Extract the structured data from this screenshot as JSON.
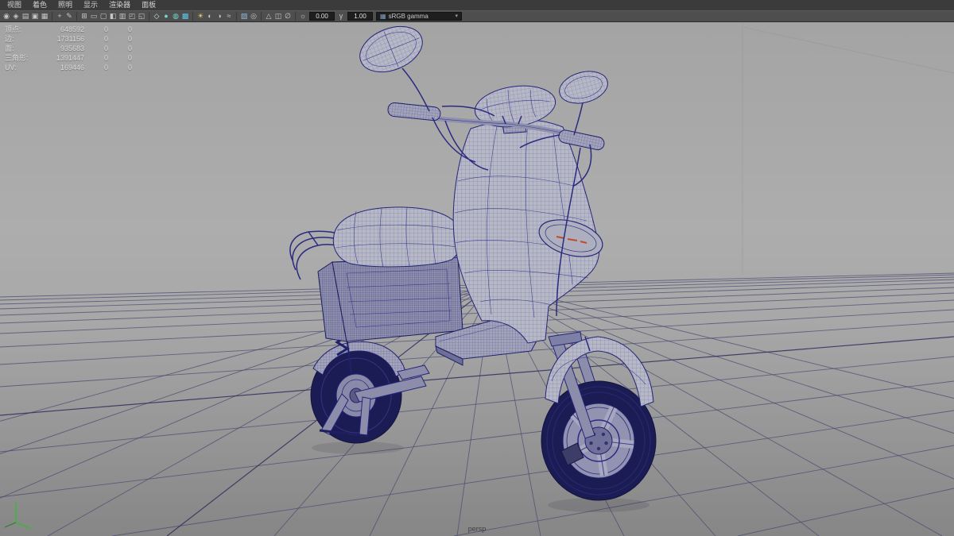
{
  "menu_bar": {
    "items": [
      {
        "name": "menu-view",
        "label": "视图"
      },
      {
        "name": "menu-shading",
        "label": "着色"
      },
      {
        "name": "menu-lighting",
        "label": "照明"
      },
      {
        "name": "menu-show",
        "label": "显示"
      },
      {
        "name": "menu-renderer",
        "label": "渲染器"
      },
      {
        "name": "menu-panels",
        "label": "面板"
      }
    ]
  },
  "toolbar": {
    "groups": {
      "camera": [
        {
          "name": "select-camera-icon",
          "glyph": "◉"
        },
        {
          "name": "lock-camera-icon",
          "glyph": "◈"
        },
        {
          "name": "camera-attributes-icon",
          "glyph": "▤"
        },
        {
          "name": "bookmark-icon",
          "glyph": "▣"
        },
        {
          "name": "image-plane-icon",
          "glyph": "▦"
        }
      ],
      "nav": [
        {
          "name": "pan-zoom-2d-icon",
          "glyph": "+"
        },
        {
          "name": "grease-pencil-icon",
          "glyph": "✎"
        }
      ],
      "gates": [
        {
          "name": "grid-toggle-icon",
          "glyph": "⊞"
        },
        {
          "name": "film-gate-icon",
          "glyph": "▭"
        },
        {
          "name": "resolution-gate-icon",
          "glyph": "▢"
        },
        {
          "name": "gate-mask-icon",
          "glyph": "◧"
        },
        {
          "name": "field-chart-icon",
          "glyph": "▥"
        },
        {
          "name": "safe-action-icon",
          "glyph": "◰"
        },
        {
          "name": "safe-title-icon",
          "glyph": "◱"
        }
      ],
      "shading": [
        {
          "name": "wireframe-icon",
          "glyph": "◇",
          "color": "#bfe8e2"
        },
        {
          "name": "smooth-shade-icon",
          "glyph": "●",
          "color": "#6fd8cb"
        },
        {
          "name": "wireframe-on-shaded-icon",
          "glyph": "◍",
          "color": "#6fd8cb"
        },
        {
          "name": "textured-icon",
          "glyph": "▩",
          "color": "#5fc4e8"
        }
      ],
      "lighting": [
        {
          "name": "use-all-lights-icon",
          "glyph": "☀",
          "color": "#e6d16a"
        },
        {
          "name": "shadows-icon",
          "glyph": "◐"
        },
        {
          "name": "screen-space-ao-icon",
          "glyph": "◑"
        },
        {
          "name": "motion-blur-icon",
          "glyph": "≈"
        }
      ],
      "effects": [
        {
          "name": "antialiasing-icon",
          "glyph": "▨",
          "color": "#8fb8d8"
        },
        {
          "name": "depth-of-field-icon",
          "glyph": "◎"
        }
      ],
      "isolate": [
        {
          "name": "isolate-select-icon",
          "glyph": "△"
        },
        {
          "name": "xray-icon",
          "glyph": "◫"
        },
        {
          "name": "xray-joints-icon",
          "glyph": "∅"
        }
      ]
    },
    "exposure": {
      "icon_glyph": "☼",
      "value": "0.00"
    },
    "gamma": {
      "icon_glyph": "γ",
      "value": "1.00"
    },
    "view_transform": {
      "swatch_glyph": "▦",
      "value": "sRGB gamma",
      "caret": "▾"
    }
  },
  "hud": {
    "rows": [
      {
        "name": "hud-vertices",
        "label": "顶点:",
        "value": "648592",
        "z1": "0",
        "z2": "0"
      },
      {
        "name": "hud-edges",
        "label": "边:",
        "value": "1731156",
        "z1": "0",
        "z2": "0"
      },
      {
        "name": "hud-faces",
        "label": "面:",
        "value": "935683",
        "z1": "0",
        "z2": "0"
      },
      {
        "name": "hud-triangles",
        "label": "三角形:",
        "value": "1391447",
        "z1": "0",
        "z2": "0"
      },
      {
        "name": "hud-uvs",
        "label": "UV:",
        "value": "169446",
        "z1": "0",
        "z2": "0"
      }
    ]
  },
  "viewport": {
    "camera_label": "persp"
  },
  "colors": {
    "viewport_top": "#a4a4a4",
    "viewport_mid": "#adadad",
    "viewport_mid2": "#a8a8a8",
    "viewport_bottom": "#868686",
    "grid_line": "#4a4a72",
    "wireframe": "#2a2a80",
    "mesh_dark": "#1c1c54",
    "menu_bg": "#3b3b3b",
    "toolbar_bg": "#4e4e4e",
    "hud_text": "#dcdcdc",
    "camera_label_text": "#3f3f3f",
    "axis_green": "#3fb53b",
    "headlight_mark_red": "#c04a32"
  }
}
